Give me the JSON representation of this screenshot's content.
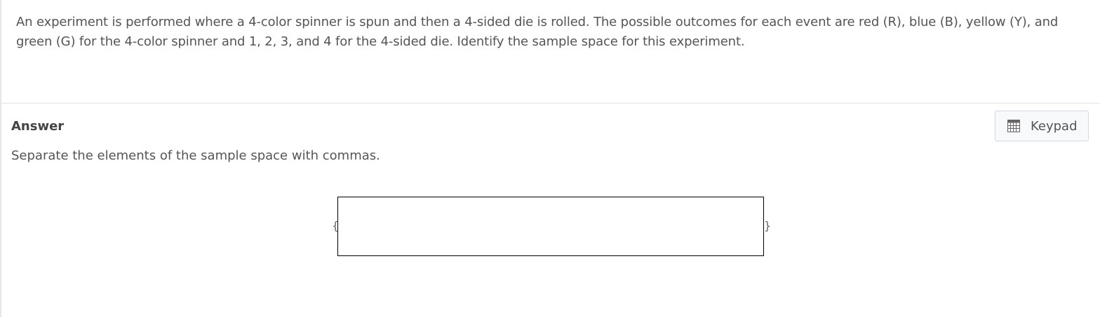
{
  "question": {
    "text": "An experiment is performed where a 4-color spinner is spun and then a 4-sided die is rolled. The possible outcomes for each event are red (R), blue (B), yellow (Y), and green (G) for the 4-color spinner and 1, 2, 3, and 4 for the 4-sided die. Identify the sample space for this experiment."
  },
  "answer": {
    "heading": "Answer",
    "instruction": "Separate the elements of the sample space with commas.",
    "open_brace": "{",
    "close_brace": "}",
    "input_value": ""
  },
  "keypad": {
    "label": "Keypad",
    "icon": "calculator-icon"
  },
  "colors": {
    "text": "#555555",
    "heading": "#444444",
    "button_border": "#cfd8e3",
    "button_bg": "#f7f9fb",
    "input_border": "#000000"
  }
}
